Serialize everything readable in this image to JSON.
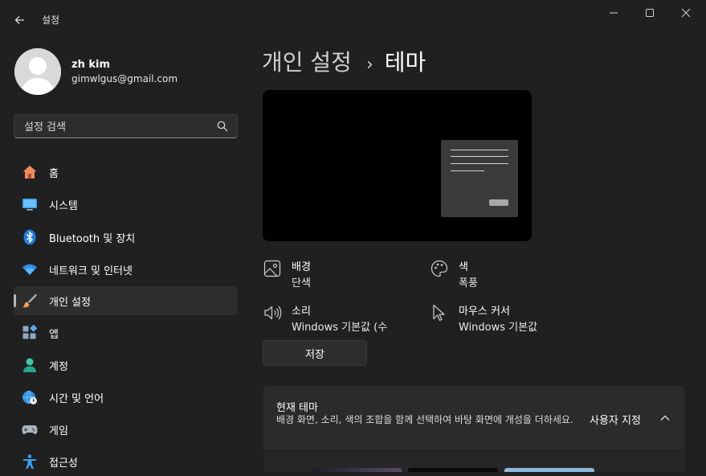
{
  "window": {
    "title": "설정"
  },
  "profile": {
    "name": "zh kim",
    "email": "gimwlgus@gmail.com"
  },
  "search": {
    "placeholder": "설정 검색"
  },
  "nav": [
    {
      "label": "홈",
      "icon": "home-icon"
    },
    {
      "label": "시스템",
      "icon": "system-icon"
    },
    {
      "label": "Bluetooth 및 장치",
      "icon": "bluetooth-icon"
    },
    {
      "label": "네트워크 및 인터넷",
      "icon": "wifi-icon"
    },
    {
      "label": "개인 설정",
      "icon": "brush-icon",
      "selected": true
    },
    {
      "label": "앱",
      "icon": "apps-icon"
    },
    {
      "label": "계정",
      "icon": "account-icon"
    },
    {
      "label": "시간 및 언어",
      "icon": "globe-clock-icon"
    },
    {
      "label": "게임",
      "icon": "gamepad-icon"
    },
    {
      "label": "접근성",
      "icon": "accessibility-icon"
    }
  ],
  "breadcrumb": {
    "parent": "개인 설정",
    "separator": "›",
    "current": "테마"
  },
  "properties": {
    "background": {
      "title": "배경",
      "value": "단색",
      "icon": "image-icon"
    },
    "color": {
      "title": "색",
      "value": "폭풍",
      "icon": "palette-icon"
    },
    "sound": {
      "title": "소리",
      "value": "Windows 기본값 (수",
      "icon": "speaker-icon"
    },
    "cursor": {
      "title": "마우스 커서",
      "value": "Windows 기본값",
      "icon": "cursor-icon"
    }
  },
  "save_button": "저장",
  "current_theme": {
    "title": "현재 테마",
    "description": "배경 화면, 소리, 색의 조합을 함께 선택하여 바탕 화면에 개성을 더하세요.",
    "value": "사용자 지정"
  },
  "colors": {
    "accent": "#4cc2ff",
    "background": "#202020",
    "selected": "#2d2d2d"
  }
}
